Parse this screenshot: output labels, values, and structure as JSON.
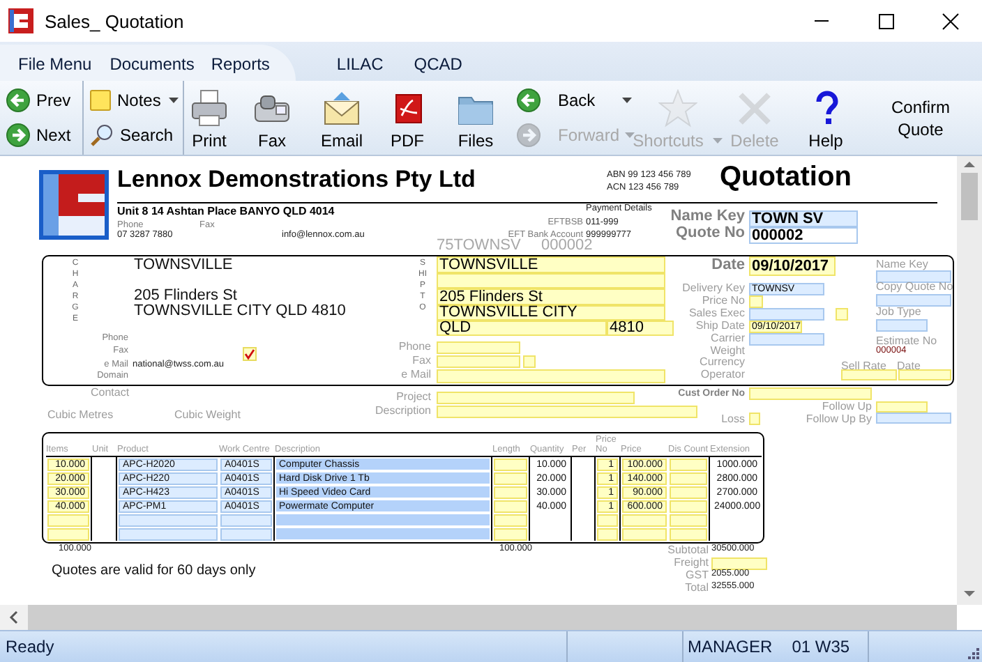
{
  "window": {
    "title": "Sales_ Quotation"
  },
  "menu": [
    {
      "label": "File Menu"
    },
    {
      "label": "Documents"
    },
    {
      "label": "Reports"
    },
    {
      "label": "LILAC"
    },
    {
      "label": "QCAD"
    }
  ],
  "toolbar": [
    {
      "kind": "stack",
      "items": [
        {
          "label": "Prev",
          "disabled": false,
          "dropdown": false
        },
        {
          "label": "Next",
          "disabled": false,
          "dropdown": false
        }
      ]
    },
    {
      "kind": "stack",
      "items": [
        {
          "label": "Notes",
          "disabled": false,
          "dropdown": true
        },
        {
          "label": "Search",
          "disabled": false,
          "dropdown": false
        }
      ]
    },
    {
      "kind": "large",
      "label": "Print",
      "disabled": false,
      "dropdown": false
    },
    {
      "kind": "large",
      "label": "Fax",
      "disabled": false,
      "dropdown": false
    },
    {
      "kind": "large",
      "label": "Email",
      "disabled": false,
      "dropdown": false
    },
    {
      "kind": "large",
      "label": "PDF",
      "disabled": false,
      "dropdown": false
    },
    {
      "kind": "large",
      "label": "Files",
      "disabled": false,
      "dropdown": false
    },
    {
      "kind": "stack",
      "items": [
        {
          "label": "Back",
          "disabled": false,
          "dropdown": true
        },
        {
          "label": "Forward",
          "disabled": true,
          "dropdown": true
        }
      ]
    },
    {
      "kind": "large",
      "label": "Shortcuts",
      "disabled": true,
      "dropdown": true
    },
    {
      "kind": "large",
      "label": "Delete",
      "disabled": true,
      "dropdown": false
    },
    {
      "kind": "large",
      "label": "Help",
      "disabled": false,
      "dropdown": false
    },
    {
      "kind": "action",
      "label": "Confirm Quote"
    }
  ],
  "form": [
    {
      "kind": "text",
      "text": "Lennox Demonstrations Pty Ltd"
    },
    {
      "kind": "text",
      "text": "Unit 8 14 Ashtan Place BANYO QLD 4014"
    },
    {
      "kind": "text",
      "text": "Phone"
    },
    {
      "kind": "text",
      "text": "07 3287 7880"
    },
    {
      "kind": "text",
      "text": "Fax"
    },
    {
      "kind": "text",
      "text": "info@lennox.com.au"
    },
    {
      "kind": "text",
      "text": "ABN 99 123 456 789"
    },
    {
      "kind": "text",
      "text": "ACN 123 456 789"
    },
    {
      "kind": "text",
      "text": "Quotation"
    },
    {
      "kind": "text",
      "text": "Payment Details"
    },
    {
      "kind": "text",
      "text": "EFTBSB"
    },
    {
      "kind": "text",
      "text": "011-999"
    },
    {
      "kind": "text",
      "text": "EFT Bank Account"
    },
    {
      "kind": "text",
      "text": "999999777"
    },
    {
      "kind": "text",
      "text": "Name Key"
    },
    {
      "kind": "field",
      "value": "TOWN SV"
    },
    {
      "kind": "text",
      "text": "Quote No"
    },
    {
      "kind": "field",
      "value": "000002"
    },
    {
      "kind": "text",
      "text": "75TOWNSV"
    },
    {
      "kind": "text",
      "text": "000002"
    },
    {
      "kind": "text",
      "text": "CHARGE"
    },
    {
      "kind": "text",
      "text": "TOWNSVILLE"
    },
    {
      "kind": "text",
      "text": "205 Flinders St"
    },
    {
      "kind": "text",
      "text": "TOWNSVILLE CITY QLD 4810"
    },
    {
      "kind": "text",
      "text": "Phone"
    },
    {
      "kind": "text",
      "text": "Fax"
    },
    {
      "kind": "check",
      "checked": true
    },
    {
      "kind": "text",
      "text": "e Mail"
    },
    {
      "kind": "text",
      "text": "national@twss.com.au"
    },
    {
      "kind": "text",
      "text": "Domain"
    },
    {
      "kind": "text",
      "text": "SHIP TO"
    },
    {
      "kind": "field",
      "value": "TOWNSVILLE"
    },
    {
      "kind": "field"
    },
    {
      "kind": "field",
      "value": "205 Flinders St"
    },
    {
      "kind": "field",
      "value": "TOWNSVILLE CITY"
    },
    {
      "kind": "field",
      "value": "QLD"
    },
    {
      "kind": "field",
      "value": "4810"
    },
    {
      "kind": "text",
      "text": "Phone"
    },
    {
      "kind": "field"
    },
    {
      "kind": "text",
      "text": "Fax"
    },
    {
      "kind": "field"
    },
    {
      "kind": "field"
    },
    {
      "kind": "text",
      "text": "e Mail"
    },
    {
      "kind": "field"
    },
    {
      "kind": "text",
      "text": "Date"
    },
    {
      "kind": "field",
      "value": "09/10/2017"
    },
    {
      "kind": "text",
      "text": "Delivery Key"
    },
    {
      "kind": "field",
      "value": "TOWNSV"
    },
    {
      "kind": "text",
      "text": "Price No"
    },
    {
      "kind": "field"
    },
    {
      "kind": "text",
      "text": "Sales Exec"
    },
    {
      "kind": "field"
    },
    {
      "kind": "field"
    },
    {
      "kind": "text",
      "text": "Ship Date"
    },
    {
      "kind": "field",
      "value": "09/10/2017"
    },
    {
      "kind": "text",
      "text": "Carrier"
    },
    {
      "kind": "field"
    },
    {
      "kind": "text",
      "text": "Weight"
    },
    {
      "kind": "text",
      "text": "Currency"
    },
    {
      "kind": "text",
      "text": "Operator"
    },
    {
      "kind": "text",
      "text": "Name Key"
    },
    {
      "kind": "field"
    },
    {
      "kind": "text",
      "text": "Copy Quote No"
    },
    {
      "kind": "field"
    },
    {
      "kind": "text",
      "text": "Job Type"
    },
    {
      "kind": "field"
    },
    {
      "kind": "text",
      "text": "Estimate No"
    },
    {
      "kind": "text",
      "text": "000004"
    },
    {
      "kind": "text",
      "text": "Sell Rate"
    },
    {
      "kind": "text",
      "text": "Date"
    },
    {
      "kind": "field"
    },
    {
      "kind": "field"
    },
    {
      "kind": "text",
      "text": "Contact"
    },
    {
      "kind": "text",
      "text": "Cubic Metres"
    },
    {
      "kind": "text",
      "text": "Cubic Weight"
    },
    {
      "kind": "text",
      "text": "Project"
    },
    {
      "kind": "field"
    },
    {
      "kind": "text",
      "text": "Description"
    },
    {
      "kind": "field"
    },
    {
      "kind": "text",
      "text": "Cust Order No"
    },
    {
      "kind": "field"
    },
    {
      "kind": "text",
      "text": "Follow Up"
    },
    {
      "kind": "field"
    },
    {
      "kind": "text",
      "text": "Loss"
    },
    {
      "kind": "field"
    },
    {
      "kind": "text",
      "text": "Follow Up By"
    },
    {
      "kind": "field"
    },
    {
      "kind": "text",
      "text": "100.000"
    },
    {
      "kind": "text",
      "text": "100.000"
    },
    {
      "kind": "text",
      "text": "Subtotal"
    },
    {
      "kind": "text",
      "text": "30500.000"
    },
    {
      "kind": "text",
      "text": "Freight"
    },
    {
      "kind": "field"
    },
    {
      "kind": "text",
      "text": "GST"
    },
    {
      "kind": "text",
      "text": "2055.000"
    },
    {
      "kind": "text",
      "text": "Total"
    },
    {
      "kind": "text",
      "text": "32555.000"
    },
    {
      "kind": "text",
      "text": "Quotes are valid for 60 days only"
    }
  ],
  "table": {
    "columns": [
      "Items",
      "Unit",
      "Product",
      "Work Centre",
      "Description",
      "Length",
      "Quantity",
      "Per",
      "Price No",
      "Price",
      "Dis Count",
      "Extension"
    ],
    "rows": [
      {
        "items": "10.000",
        "product": "APC-H2020",
        "work_centre": "A0401S",
        "description": "Computer Chassis",
        "quantity": "10.000",
        "price_no": "1",
        "price": "100.000",
        "extension": "1000.000"
      },
      {
        "items": "20.000",
        "product": "APC-H220",
        "work_centre": "A0401S",
        "description": "Hard Disk Drive 1 Tb",
        "quantity": "20.000",
        "price_no": "1",
        "price": "140.000",
        "extension": "2800.000"
      },
      {
        "items": "30.000",
        "product": "APC-H423",
        "work_centre": "A0401S",
        "description": "Hi Speed Video Card",
        "quantity": "30.000",
        "price_no": "1",
        "price": "90.000",
        "extension": "2700.000"
      },
      {
        "items": "40.000",
        "product": "APC-PM1",
        "work_centre": "A0401S",
        "description": "Powermate Computer",
        "quantity": "40.000",
        "price_no": "1",
        "price": "600.000",
        "extension": "24000.000"
      }
    ]
  },
  "status_bar": {
    "message": "Ready",
    "user": "MANAGER",
    "period": "01 W35"
  }
}
